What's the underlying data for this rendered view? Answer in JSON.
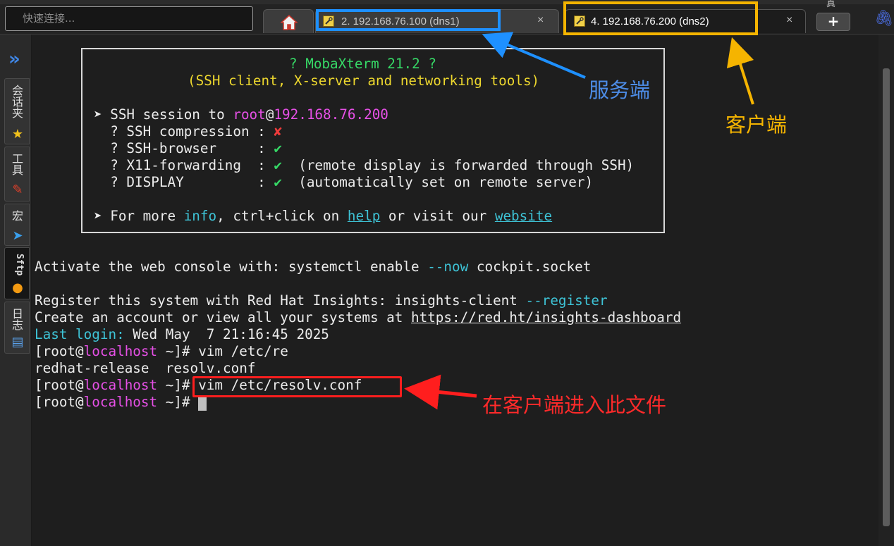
{
  "top": {
    "quick_placeholder": "快速连接...",
    "tabs": [
      {
        "label": "2. 192.168.76.100 (dns1)",
        "close": "×"
      },
      {
        "label": "4. 192.168.76.200 (dns2)",
        "close": "×"
      }
    ],
    "plus": "+",
    "clip": "🖇",
    "cut_text": "真"
  },
  "sidebar": {
    "tabs": [
      {
        "label": "会话夹",
        "icon": "star-icon"
      },
      {
        "label": "工具",
        "icon": "tools-icon"
      },
      {
        "label": "宏",
        "icon": "send-icon"
      },
      {
        "label": "Sftp",
        "icon": "sftp-icon"
      },
      {
        "label": "日志",
        "icon": "log-icon"
      }
    ]
  },
  "banner": {
    "title": "? MobaXterm 21.2 ?",
    "subtitle": "(SSH client, X-server and networking tools)",
    "session_prefix": "➤ SSH session to ",
    "user": "root",
    "at": "@",
    "host": "192.168.76.200",
    "features": [
      {
        "name": "  ? SSH compression : ",
        "mark": "✘",
        "mark_color": "#ef3b3b",
        "note": ""
      },
      {
        "name": "  ? SSH-browser     : ",
        "mark": "✔",
        "mark_color": "#36d866",
        "note": ""
      },
      {
        "name": "  ? X11-forwarding  : ",
        "mark": "✔",
        "mark_color": "#36d866",
        "note": "  (remote display is forwarded through SSH)"
      },
      {
        "name": "  ? DISPLAY         : ",
        "mark": "✔",
        "mark_color": "#36d866",
        "note": "  (automatically set on remote server)"
      }
    ],
    "more_1": "➤ For more ",
    "more_info": "info",
    "more_2": ", ctrl+click on ",
    "more_help": "help",
    "more_3": " or visit our ",
    "more_website": "website"
  },
  "terminal": {
    "web_1": "Activate the web console with: systemctl enable ",
    "web_flag": "--now",
    "web_2": " cockpit.socket",
    "insights_1": "Register this system with Red Hat Insights: insights-client ",
    "insights_flag": "--register",
    "account_1": "Create an account or view all your systems at ",
    "account_link": "https://red.ht/insights-dashboard",
    "last_label": "Last login:",
    "last_value": " Wed May  7 21:16:45 2025",
    "prompt_a": "[root@",
    "prompt_host": "localhost",
    "prompt_b": " ~]# ",
    "cmd1": "vim /etc/re",
    "completion": "redhat-release  resolv.conf",
    "cmd2": "vim /etc/resolv.conf"
  },
  "annotations": {
    "server": "服务端",
    "client": "客户端",
    "enter_file": "在客户端进入此文件",
    "colors": {
      "blue": "#1e90ff",
      "orange": "#f5b400",
      "red": "#ff1e1e"
    }
  }
}
